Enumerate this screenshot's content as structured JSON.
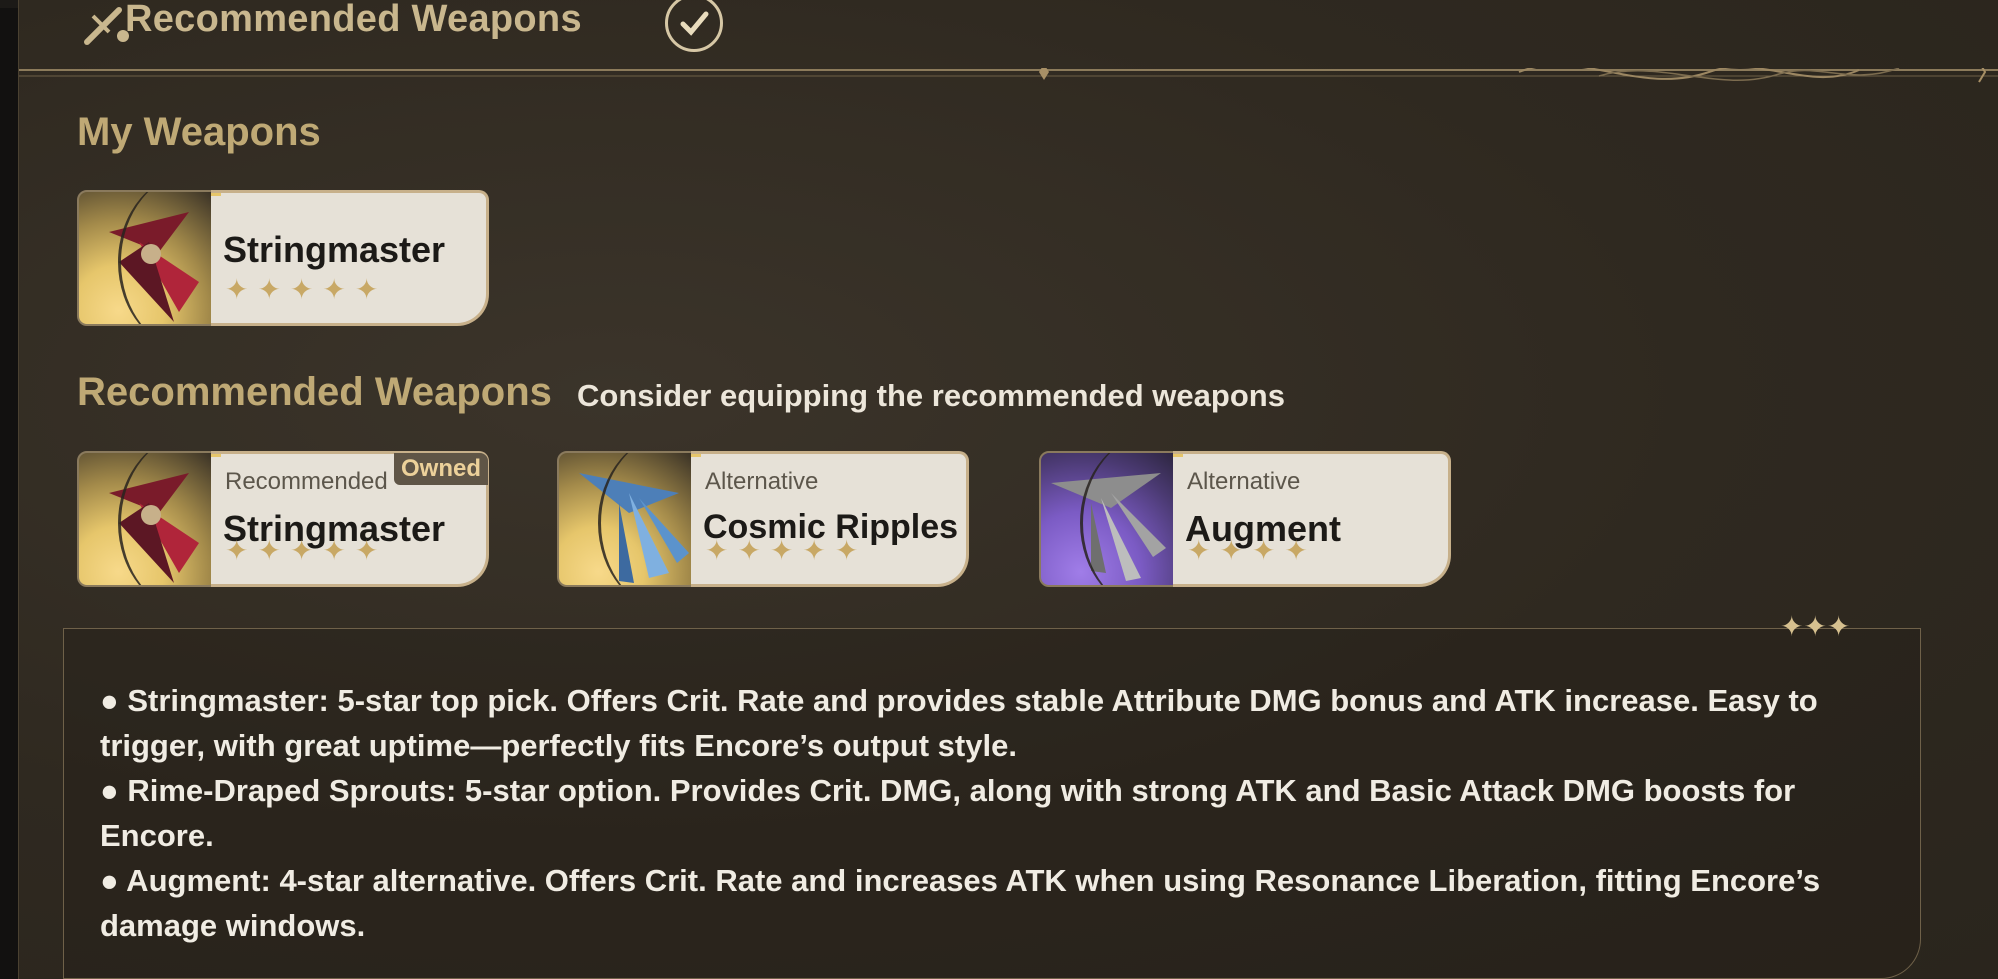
{
  "header": {
    "title": "Recommended Weapons"
  },
  "my_weapons": {
    "title": "My Weapons",
    "items": [
      {
        "name": "Stringmaster",
        "stars": "✦✦✦✦✦",
        "rarity": 5
      }
    ]
  },
  "recommended": {
    "title": "Recommended Weapons",
    "subtitle": "Consider equipping the recommended weapons",
    "items": [
      {
        "tag": "Recommended",
        "badge": "Owned",
        "name": "Stringmaster",
        "stars": "✦✦✦✦✦",
        "rarity": 5
      },
      {
        "tag": "Alternative",
        "name": "Cosmic Ripples",
        "stars": "✦✦✦✦✦",
        "rarity": 5
      },
      {
        "tag": "Alternative",
        "name": "Augment",
        "stars": "✦✦✦✦",
        "rarity": 4
      }
    ]
  },
  "notes": {
    "lines": [
      "● Stringmaster: 5-star top pick. Offers Crit. Rate and provides stable Attribute DMG bonus and ATK increase. Easy to trigger, with great uptime—perfectly fits Encore’s output style.",
      "● Rime-Draped Sprouts: 5-star option. Provides Crit. DMG, along with strong ATK and Basic Attack DMG boosts for Encore.",
      "● Augment: 4-star alternative. Offers Crit. Rate and increases ATK when using Resonance Liberation, fitting Encore’s damage windows."
    ]
  },
  "colors": {
    "panel_bg": "#2f2920",
    "gold_title": "#bfa975",
    "card_bg": "#e6e1d7",
    "star": "#c8a865",
    "five_star_thumb": "#e6c66b",
    "four_star_thumb": "#7b5bc4"
  },
  "icons": [
    "sword-icon",
    "check-circle-icon",
    "sparkle-icon",
    "star-icon"
  ]
}
